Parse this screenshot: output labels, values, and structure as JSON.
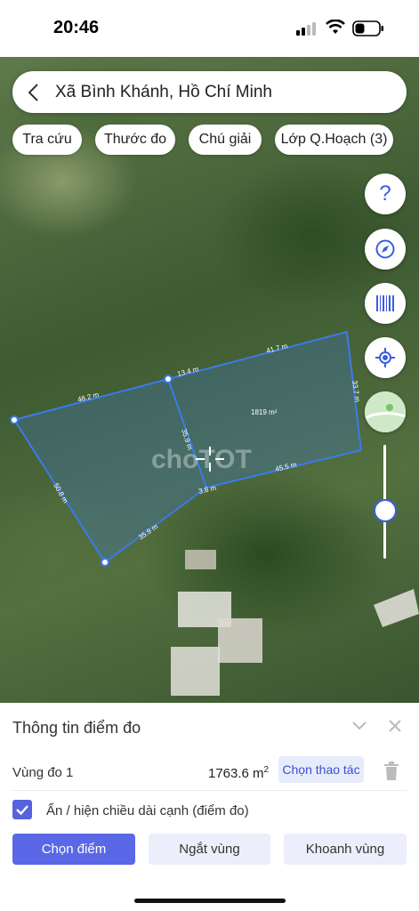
{
  "status_bar": {
    "time": "20:46"
  },
  "search": {
    "location": "Xã Bình Khánh, Hồ Chí Minh"
  },
  "chips": [
    {
      "label": "Tra cứu"
    },
    {
      "label": "Thước đo"
    },
    {
      "label": "Chú giải"
    },
    {
      "label": "Lớp Q.Hoạch (3)"
    }
  ],
  "fab": {
    "help_label": "?"
  },
  "map": {
    "edge_labels": [
      "48.2 m",
      "13.4 m",
      "41.7 m",
      "33.7 m",
      "45.5 m",
      "3.8 m",
      "35.9 m",
      "50.8 m",
      "35.9 m"
    ],
    "area_label": "1819 m²",
    "watermark": "choTOT",
    "slider_level": 0.72
  },
  "sheet": {
    "title": "Thông tin điểm đo",
    "zone_label": "Vùng đo 1",
    "area_value": "1763.6 m",
    "area_sup": "2",
    "action_button": "Chọn thao tác",
    "checkbox_label": "Ẩn / hiện chiều dài cạnh (điểm đo)",
    "buttons": [
      "Chọn điểm",
      "Ngắt vùng",
      "Khoanh vùng"
    ]
  },
  "colors": {
    "accent": "#5a67e6",
    "polygon": "#3a7bea"
  }
}
